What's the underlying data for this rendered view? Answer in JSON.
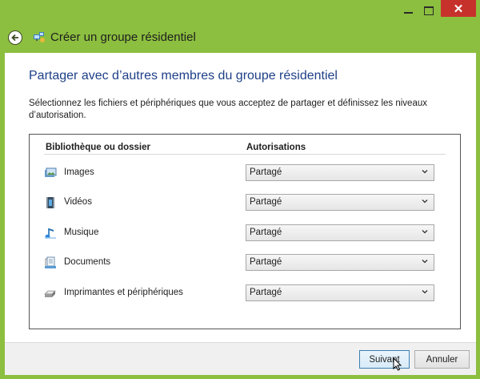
{
  "window": {
    "title": "Créer un groupe résidentiel",
    "close_glyph": "✕",
    "accent_color": "#8cbf3f",
    "close_color": "#c7312b"
  },
  "page": {
    "heading": "Partager avec d’autres membres du groupe résidentiel",
    "description": "Sélectionnez les fichiers et périphériques que vous acceptez de partager et définissez les niveaux d’autorisation."
  },
  "table": {
    "col_library": "Bibliothèque ou dossier",
    "col_permissions": "Autorisations",
    "rows": [
      {
        "label": "Images",
        "icon": "pictures-library-icon",
        "permission": "Partagé"
      },
      {
        "label": "Vidéos",
        "icon": "videos-library-icon",
        "permission": "Partagé"
      },
      {
        "label": "Musique",
        "icon": "music-library-icon",
        "permission": "Partagé"
      },
      {
        "label": "Documents",
        "icon": "documents-library-icon",
        "permission": "Partagé"
      },
      {
        "label": "Imprimantes et périphériques",
        "icon": "printer-icon",
        "permission": "Partagé"
      }
    ]
  },
  "footer": {
    "next_label": "Suivant",
    "cancel_label": "Annuler"
  }
}
